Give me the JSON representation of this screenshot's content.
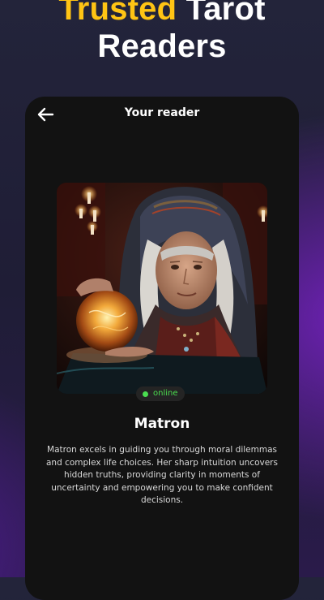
{
  "promo": {
    "headline_accent": "Trusted",
    "headline_rest": " Tarot",
    "headline_line2": "Readers"
  },
  "screen": {
    "title": "Your reader",
    "back_icon": "arrow-left-icon"
  },
  "reader": {
    "status": "online",
    "status_color": "#4ade50",
    "name": "Matron",
    "description": "Matron excels in guiding you through moral dilemmas and complex life choices. Her sharp intuition uncovers hidden truths, providing clarity in moments of uncertainty and empowering you to make confident decisions."
  },
  "colors": {
    "accent": "#ffc414",
    "card_background": "#121212"
  }
}
